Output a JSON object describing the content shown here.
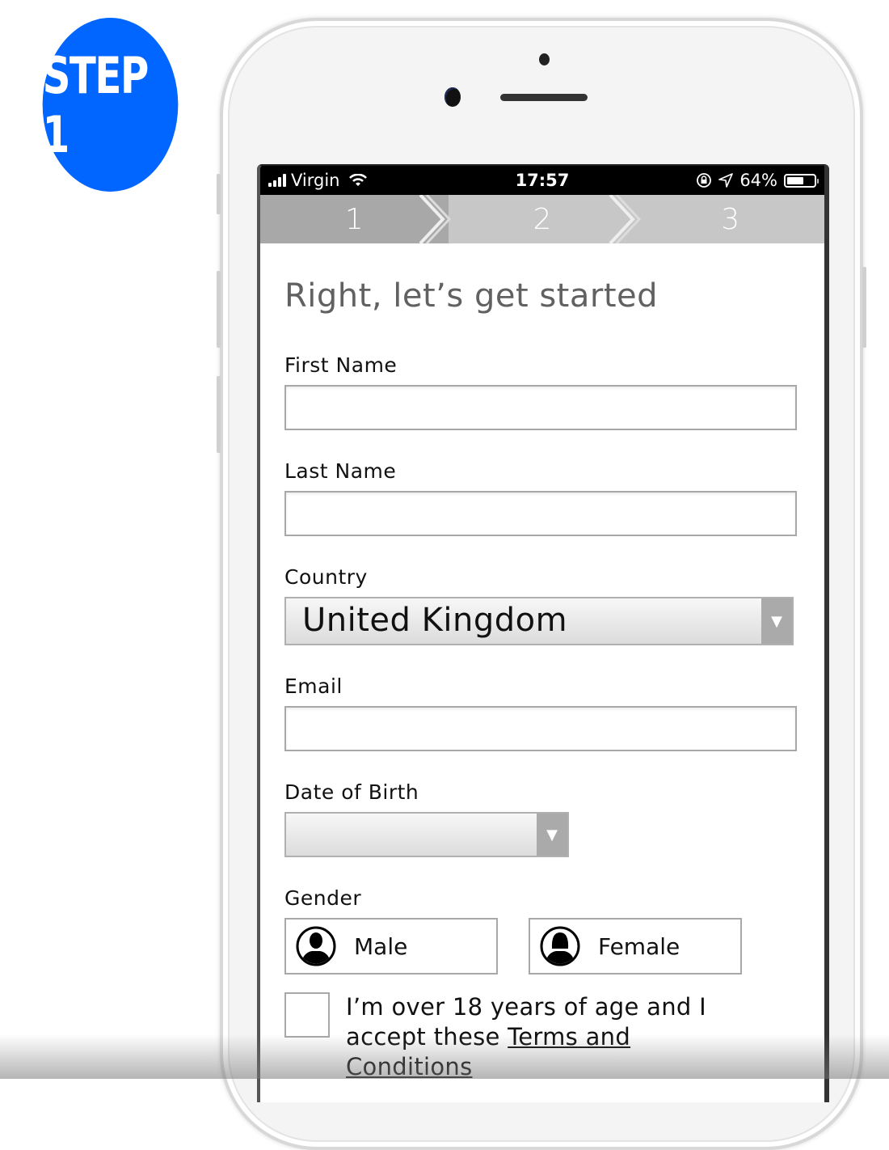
{
  "badge": {
    "line1": "STEP",
    "line2": "1"
  },
  "status_bar": {
    "carrier": "Virgin",
    "time": "17:57",
    "battery_percent": "64%",
    "battery_level": 0.64,
    "icons": [
      "signal-icon",
      "wifi-icon",
      "rotation-lock-icon",
      "location-icon",
      "battery-icon"
    ]
  },
  "progress": {
    "steps": [
      "1",
      "2",
      "3"
    ],
    "current_step": 1
  },
  "form": {
    "title": "Right, let’s get started",
    "first_name": {
      "label": "First Name",
      "value": ""
    },
    "last_name": {
      "label": "Last Name",
      "value": ""
    },
    "country": {
      "label": "Country",
      "value": "United Kingdom"
    },
    "email": {
      "label": "Email",
      "value": ""
    },
    "dob": {
      "label": "Date of Birth",
      "value": ""
    },
    "gender": {
      "label": "Gender",
      "options": [
        "Male",
        "Female"
      ]
    },
    "terms": {
      "text": "I’m over 18 years of age and I accept these ",
      "link": "Terms and Conditions",
      "checked": false
    }
  },
  "colors": {
    "badge": "#0066ff",
    "progress_active": "#a8a8a8",
    "progress_inactive": "#c7c7c7"
  }
}
